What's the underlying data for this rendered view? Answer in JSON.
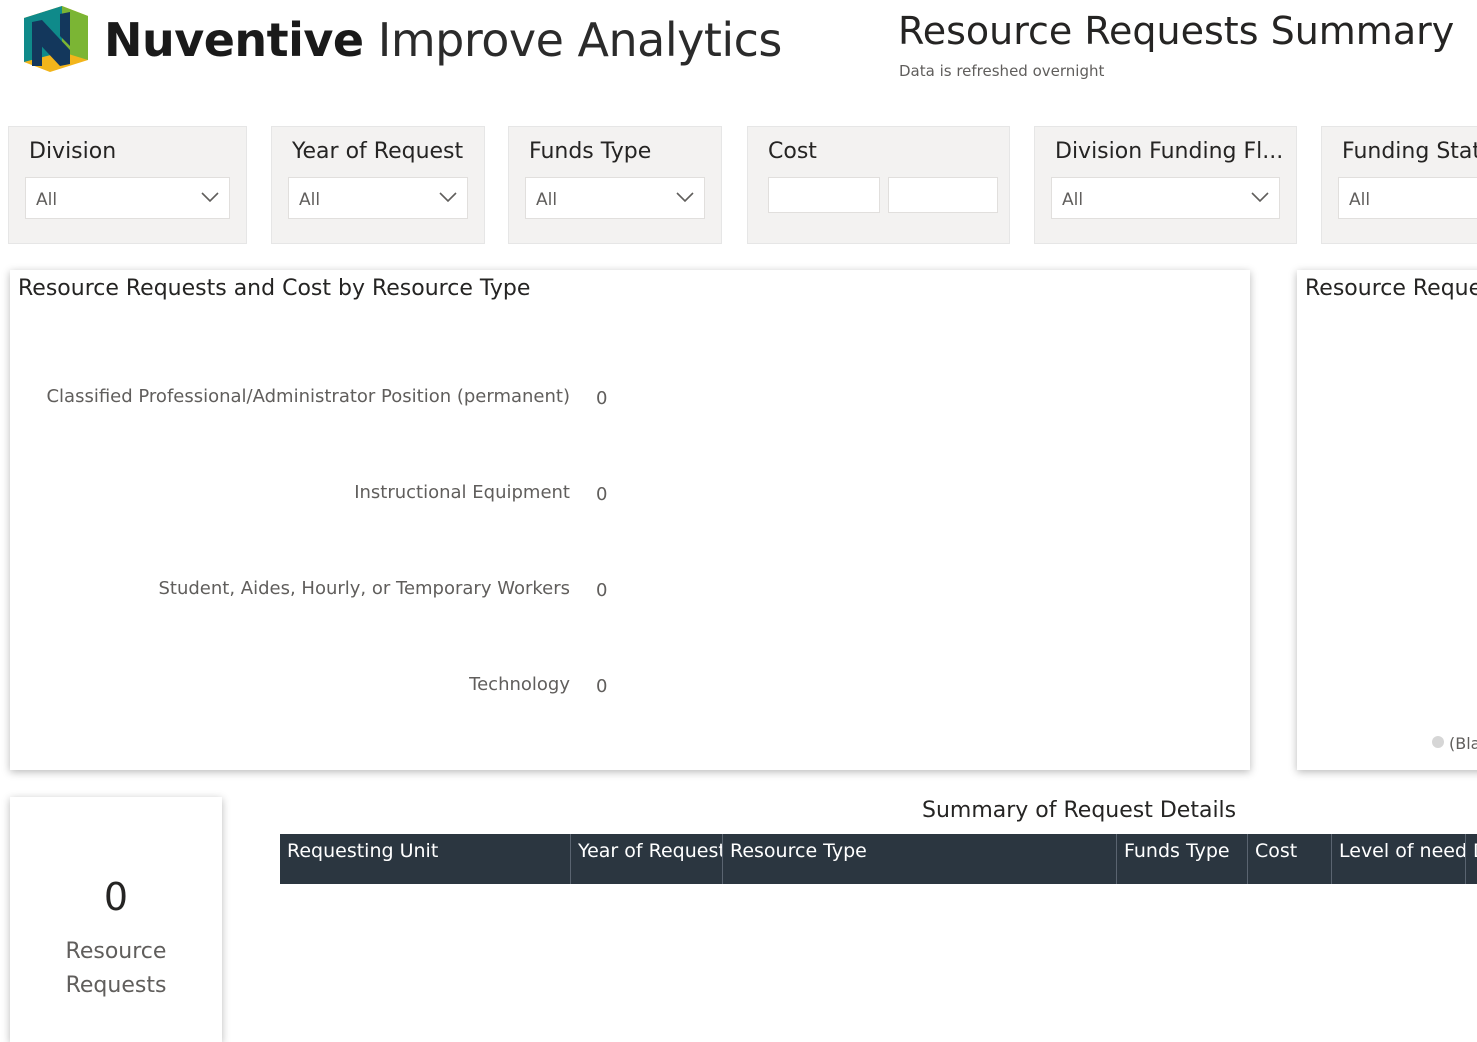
{
  "header": {
    "brand_bold": "Nuventive",
    "brand_light": " Improve Analytics",
    "title": "Resource Requests Summary",
    "subtitle": "Data is refreshed overnight"
  },
  "colors": {
    "logo_teal": "#0f8a8a",
    "logo_green": "#7bb534",
    "logo_yellow": "#f2b51b",
    "logo_navy": "#13375c",
    "table_header": "#2b3640",
    "slicer_bg": "#f3f2f1"
  },
  "filters": [
    {
      "label": "Division",
      "value": "All"
    },
    {
      "label": "Year of Request",
      "value": "All"
    },
    {
      "label": "Funds Type",
      "value": "All"
    },
    {
      "label": "Cost",
      "min": "",
      "max": ""
    },
    {
      "label": "Division Funding Fl...",
      "value": "All"
    },
    {
      "label": "Funding Statu",
      "value": "All"
    }
  ],
  "panels": {
    "bar_title": "Resource Requests and Cost by Resource Type",
    "right_title": "Resource Reque",
    "right_legend": "(Bla"
  },
  "chart_data": {
    "type": "bar",
    "orientation": "horizontal",
    "title": "Resource Requests and Cost by Resource Type",
    "categories": [
      "Classified Professional/Administrator Position (permanent)",
      "Instructional Equipment",
      "Student, Aides, Hourly, or Temporary Workers",
      "Technology"
    ],
    "values": [
      0,
      0,
      0,
      0
    ],
    "data_labels": [
      "0",
      "0",
      "0",
      "0"
    ]
  },
  "kpi": {
    "value": "0",
    "label_line1": "Resource",
    "label_line2": "Requests"
  },
  "table": {
    "title": "Summary of Request Details",
    "columns": [
      "Requesting Unit",
      "Year of Request",
      "Resource Type",
      "Funds Type",
      "Cost",
      "Level of need",
      "D"
    ]
  }
}
